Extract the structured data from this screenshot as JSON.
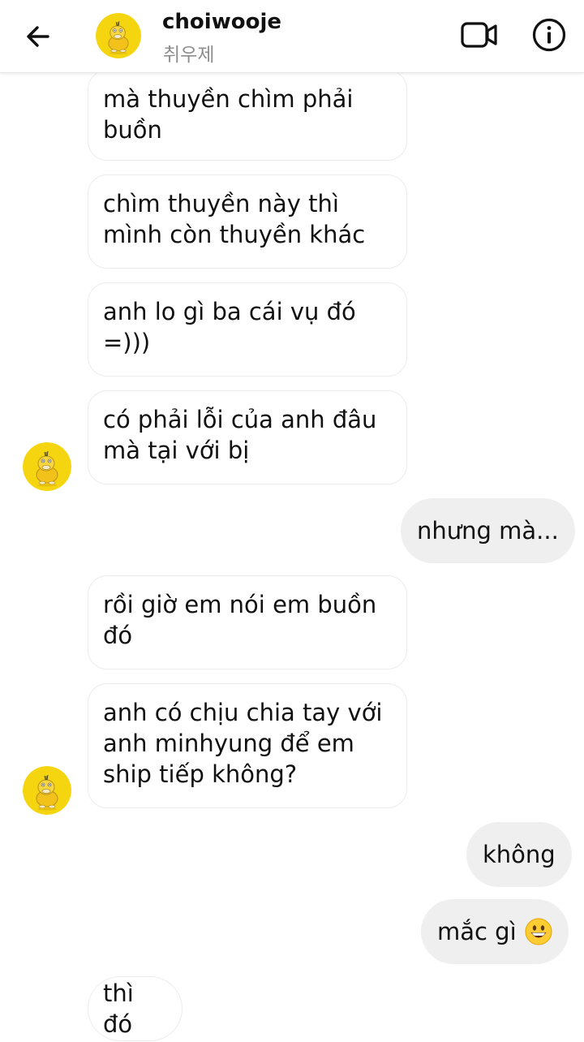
{
  "header": {
    "name": "choiwooje",
    "subtitle": "취우제",
    "back_icon": "arrow-left-icon",
    "video_icon": "video-camera-icon",
    "info_icon": "info-icon"
  },
  "colors": {
    "incoming_bubble_bg": "#ffffff",
    "outgoing_bubble_bg": "#efefef",
    "avatar_bg": "#f5d50f",
    "subtitle": "#8e8e8e"
  },
  "messages": [
    {
      "from": "them",
      "text": "mà thuyền chìm phải buồn"
    },
    {
      "from": "them",
      "text": "chìm thuyền này thì mình còn thuyền khác"
    },
    {
      "from": "them",
      "text": "anh lo gì ba cái vụ đó =)))"
    },
    {
      "from": "them",
      "text": "có phải lỗi của anh đâu mà tại với bị"
    },
    {
      "from": "me",
      "text": "nhưng mà..."
    },
    {
      "from": "them",
      "text": "rồi giờ em nói em buồn đó"
    },
    {
      "from": "them",
      "text": "anh có chịu chia tay với anh minhyung để em ship tiếp không?"
    },
    {
      "from": "me",
      "text": "không"
    },
    {
      "from": "me",
      "text": "mắc gì",
      "emoji": "grinning-face-emoji"
    },
    {
      "from": "them",
      "text": "thì đó"
    }
  ]
}
